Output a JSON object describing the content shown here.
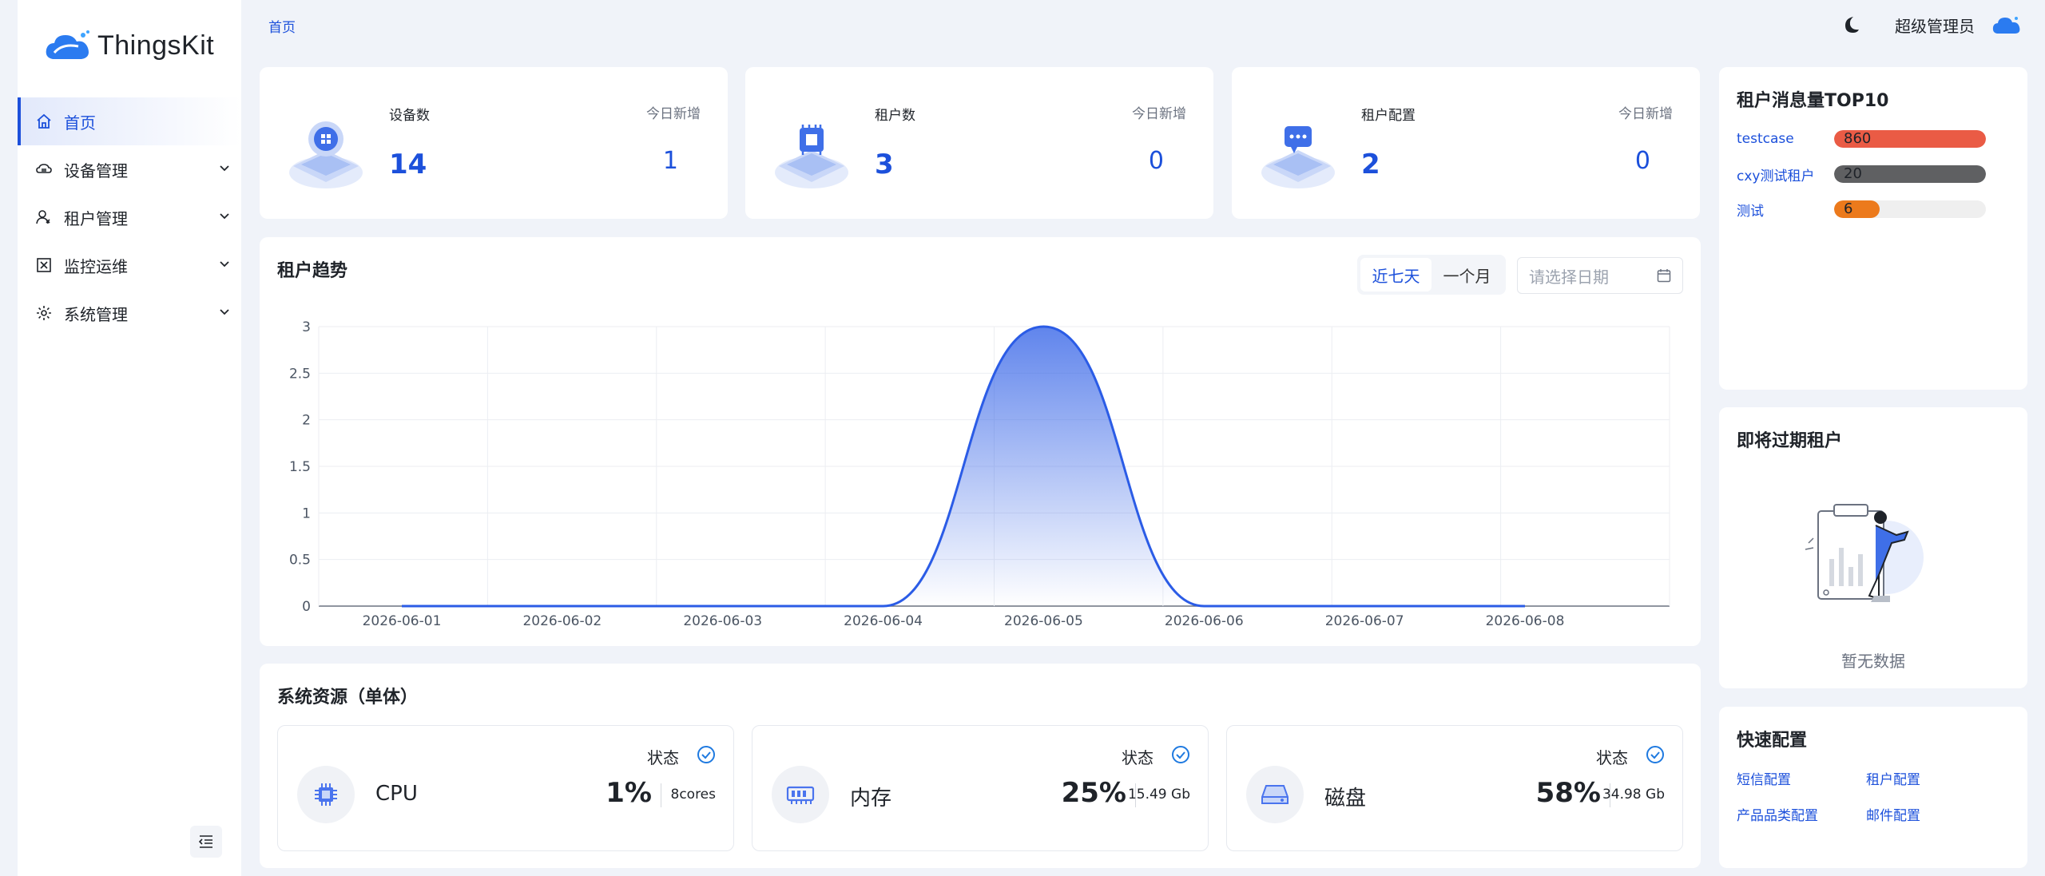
{
  "app": {
    "name": "ThingsKit"
  },
  "sidebar": {
    "items": [
      {
        "label": "首页",
        "icon": "home-icon",
        "active": true
      },
      {
        "label": "设备管理",
        "icon": "cloud-device-icon"
      },
      {
        "label": "租户管理",
        "icon": "user-manage-icon"
      },
      {
        "label": "监控运维",
        "icon": "monitor-icon"
      },
      {
        "label": "系统管理",
        "icon": "gear-icon"
      }
    ]
  },
  "header": {
    "breadcrumb": "首页",
    "user": "超级管理员"
  },
  "stats": [
    {
      "label": "设备数",
      "value": "14",
      "new_label": "今日新增",
      "new_value": "1",
      "icon": "device-icon"
    },
    {
      "label": "租户数",
      "value": "3",
      "new_label": "今日新增",
      "new_value": "0",
      "icon": "tenant-icon"
    },
    {
      "label": "租户配置",
      "value": "2",
      "new_label": "今日新增",
      "new_value": "0",
      "icon": "tenant-config-icon"
    }
  ],
  "trend": {
    "title": "租户趋势",
    "range_options": [
      "近七天",
      "一个月"
    ],
    "selected_range": "近七天",
    "date_placeholder": "请选择日期"
  },
  "chart_data": {
    "type": "area",
    "x": [
      "2026-06-01",
      "2026-06-02",
      "2026-06-03",
      "2026-06-04",
      "2026-06-05",
      "2026-06-06",
      "2026-06-07",
      "2026-06-08"
    ],
    "series": [
      {
        "values": [
          0,
          0,
          0,
          0,
          3,
          0,
          0,
          0
        ]
      }
    ],
    "ylim": [
      0,
      3
    ],
    "yticks": [
      "0",
      "0.5",
      "1",
      "1.5",
      "2",
      "2.5",
      "3"
    ],
    "grid": true,
    "color": "#2b5ce6"
  },
  "resources": {
    "title": "系统资源（单体）",
    "items": [
      {
        "name": "CPU",
        "status": "状态",
        "percent": "1%",
        "detail": "8cores",
        "icon": "cpu-icon"
      },
      {
        "name": "内存",
        "status": "状态",
        "percent": "25%",
        "detail": "15.49 Gb",
        "icon": "memory-icon"
      },
      {
        "name": "磁盘",
        "status": "状态",
        "percent": "58%",
        "detail": "34.98 Gb",
        "icon": "disk-icon"
      }
    ]
  },
  "top10": {
    "title": "租户消息量TOP10",
    "rows": [
      {
        "name": "testcase",
        "value": "860",
        "fraction": 1.0,
        "color": "#ea5b45"
      },
      {
        "name": "cxy测试租户",
        "value": "20",
        "fraction": 1.0,
        "color": "#5f6062"
      },
      {
        "name": "测试",
        "value": "6",
        "fraction": 0.3,
        "color": "#ec7a1c"
      }
    ]
  },
  "expiring": {
    "title": "即将过期租户",
    "empty_text": "暂无数据"
  },
  "quick": {
    "title": "快速配置",
    "links": [
      "短信配置",
      "租户配置",
      "产品品类配置",
      "邮件配置"
    ]
  }
}
